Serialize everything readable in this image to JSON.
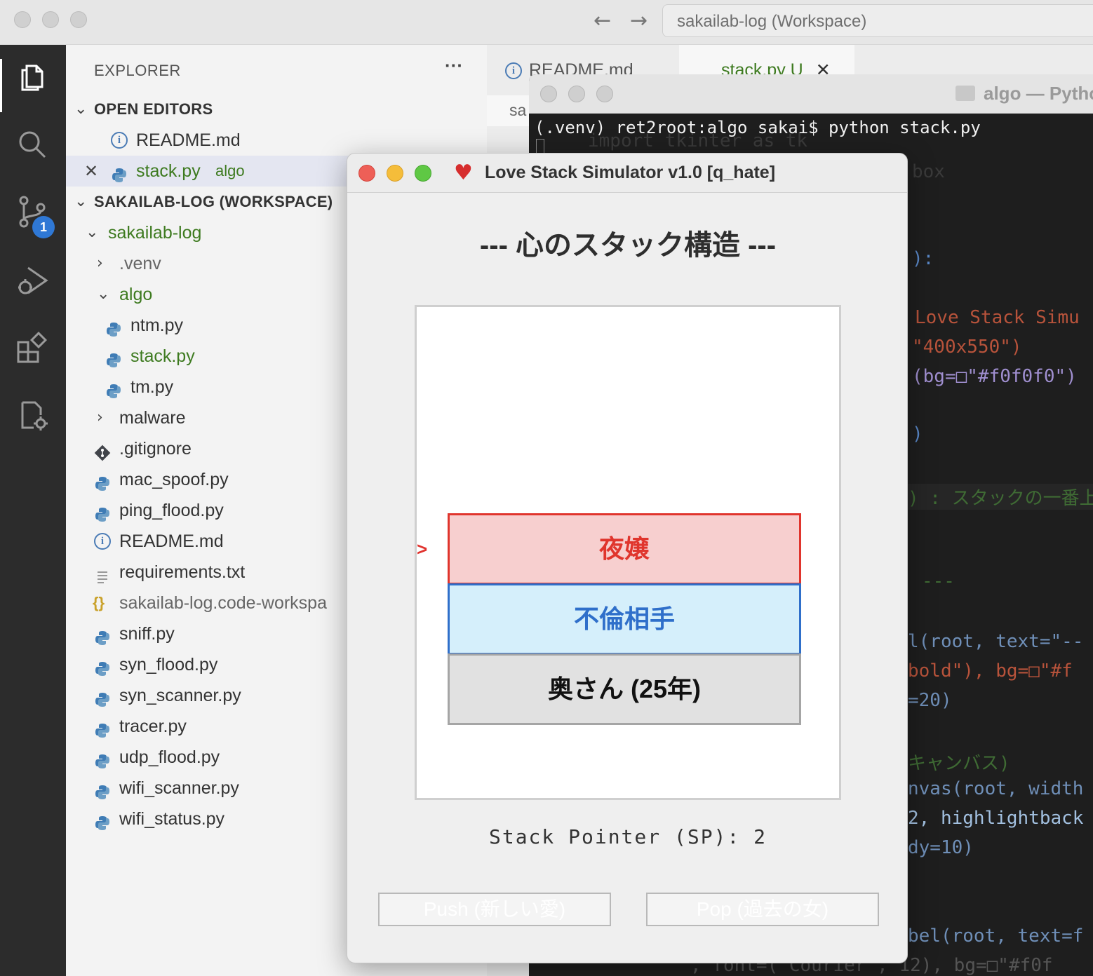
{
  "window": {
    "search_text": "sakailab-log (Workspace)"
  },
  "activity": {
    "badge_count": "1"
  },
  "explorer": {
    "title": "EXPLORER",
    "more": "···",
    "open_editors_label": "OPEN EDITORS",
    "open_editors": [
      {
        "name": "README.md",
        "icon": "info-icon"
      },
      {
        "name": "stack.py",
        "folder": "algo",
        "icon": "python-icon"
      }
    ],
    "workspace_label": "SAKAILAB-LOG (WORKSPACE)",
    "tree": [
      {
        "name": "sakailab-log",
        "kind": "folder-open"
      },
      {
        "name": ".venv",
        "kind": "folder-closed"
      },
      {
        "name": "algo",
        "kind": "folder-open"
      },
      {
        "name": "ntm.py",
        "kind": "python"
      },
      {
        "name": "stack.py",
        "kind": "python"
      },
      {
        "name": "tm.py",
        "kind": "python"
      },
      {
        "name": "malware",
        "kind": "folder-closed"
      },
      {
        "name": ".gitignore",
        "kind": "git"
      },
      {
        "name": "mac_spoof.py",
        "kind": "python"
      },
      {
        "name": "ping_flood.py",
        "kind": "python"
      },
      {
        "name": "README.md",
        "kind": "info"
      },
      {
        "name": "requirements.txt",
        "kind": "text"
      },
      {
        "name": "sakailab-log.code-workspa",
        "kind": "json"
      },
      {
        "name": "sniff.py",
        "kind": "python"
      },
      {
        "name": "syn_flood.py",
        "kind": "python"
      },
      {
        "name": "syn_scanner.py",
        "kind": "python"
      },
      {
        "name": "tracer.py",
        "kind": "python"
      },
      {
        "name": "udp_flood.py",
        "kind": "python"
      },
      {
        "name": "wifi_scanner.py",
        "kind": "python"
      },
      {
        "name": "wifi_status.py",
        "kind": "python"
      }
    ]
  },
  "tabs": [
    {
      "label": "README.md"
    },
    {
      "label": "stack.py U"
    }
  ],
  "breadcrumb": "sa",
  "terminal": {
    "title": "algo — Pytho",
    "prompt": "(.venv) ret2root:algo sakai$ python stack.py",
    "code_lines": [
      "import tkinter as tk",
      "box",
      "):",
      "Love Stack Simu",
      "\"400x550\")",
      "(bg=□\"#f0f0f0\")",
      ")",
      ") : スタックの一番上",
      "---",
      "l(root, text=\"--",
      "bold\"), bg=□\"#f",
      "=20)",
      "キャンバス)",
      "nvas(root, width",
      "2, highlightback",
      "dy=10)",
      "bel(root, text=f",
      ", font=(\"Courier\", 12), bg=□\"#f0f"
    ]
  },
  "app": {
    "title": "Love Stack Simulator v1.0 [q_hate]",
    "heading": "--- 心のスタック構造 ---",
    "stack_items": [
      "夜嬢",
      "不倫相手",
      "奥さん (25年)"
    ],
    "pointer_mark": ">",
    "sp_label": "Stack Pointer (SP): 2",
    "stack_pointer": 2,
    "push_label": "Push (新しい愛)",
    "pop_label": "Pop (過去の女)",
    "colors": {
      "top_fill": "#f7cfcf",
      "top_border": "#e0352d",
      "mid_fill": "#d5effb",
      "mid_border": "#2f6fca",
      "bottom_fill": "#e1e1e1"
    }
  }
}
